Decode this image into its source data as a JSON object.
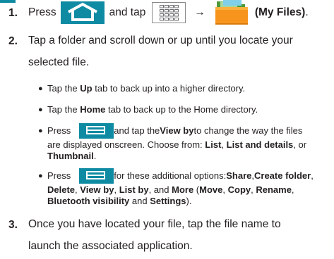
{
  "step1": {
    "number": "1.",
    "press": "Press",
    "and_tap": "and tap",
    "arrow": "→",
    "my_files": "(My Files)",
    "period": ".",
    "icons": [
      "home-key-icon",
      "applications-grid-icon",
      "my-files-folder-icon"
    ]
  },
  "step2": {
    "number": "2.",
    "line1": "Tap a folder and scroll down or up until you locate your",
    "line2": "selected file.",
    "bullets": {
      "up": {
        "pre": "Tap the ",
        "bold": "Up",
        "post": " tab to back up into a higher directory."
      },
      "home": {
        "pre": "Tap the ",
        "bold": "Home",
        "post": " tab to back up to the Home directory."
      },
      "viewby": {
        "press": "Press",
        "t1": " and tap the ",
        "b1": "View by",
        "t2": " to change the way the files",
        "line2_pre": "are displayed onscreen. Choose from: ",
        "b2": "List",
        "t3": ", ",
        "b3": "List and details",
        "t4": ", or",
        "b4": "Thumbnail",
        "t5": "."
      },
      "options": {
        "press": "Press",
        "t1": " for these additional options: ",
        "b1": "Share",
        "t2": ", ",
        "b2": "Create folder",
        "t3": ",",
        "b3": "Delete",
        "t4": ", ",
        "b4": "View by",
        "t5": ", ",
        "b5": "List by",
        "t6": ", and ",
        "b6": "More",
        "t7": " (",
        "b7": "Move",
        "t8": ", ",
        "b8": "Copy",
        "t9": ", ",
        "b9": "Rename",
        "t10": ",",
        "b10": "Bluetooth visibility",
        "t11": " and ",
        "b11": "Settings",
        "t12": ")."
      }
    }
  },
  "step3": {
    "number": "3.",
    "line1": "Once you have located your file, tap the file name to",
    "line2": "launch the associated application."
  },
  "colors": {
    "accent": "#0e8ba3",
    "folder": "#f7941d",
    "text": "#231f20"
  }
}
